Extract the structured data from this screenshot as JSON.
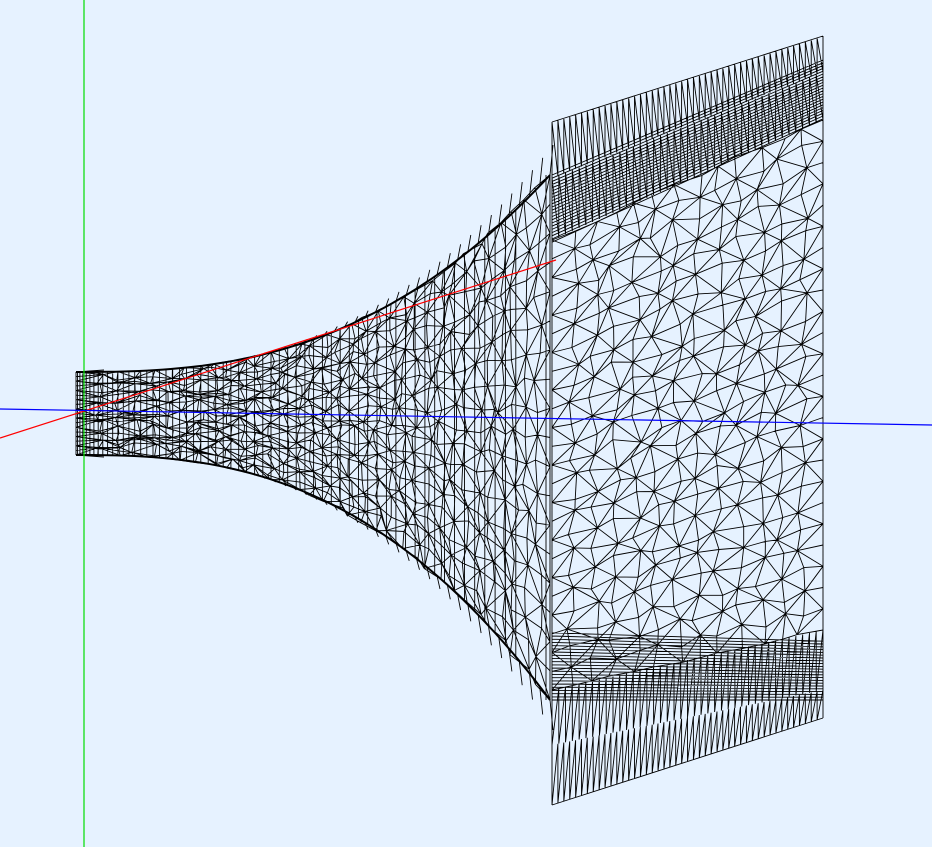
{
  "viewport": {
    "background_color": "#e6f2ff",
    "mesh_color": "#000000",
    "mesh_fill_color": "#ffffff",
    "axis_colors": {
      "x": "#ff0000",
      "y": "#00dd00",
      "z": "#0000ff"
    },
    "model": "horn-mesh",
    "render_mode": "wireframe"
  }
}
